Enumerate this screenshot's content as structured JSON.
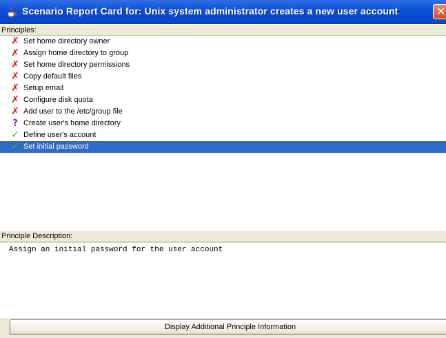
{
  "window": {
    "title": "Scenario Report Card for: Unix system administrator creates a new user account",
    "close_glyph": "✕",
    "title_icon": "java-coffee-icon"
  },
  "principles": {
    "header": "Principles:",
    "items": [
      {
        "label": "Set home directory owner",
        "status": "fail",
        "glyph": "✗"
      },
      {
        "label": "Assign home directory to group",
        "status": "fail",
        "glyph": "✗"
      },
      {
        "label": "Set home directory permissions",
        "status": "fail",
        "glyph": "✗"
      },
      {
        "label": "Copy default files",
        "status": "fail",
        "glyph": "✗"
      },
      {
        "label": "Setup email",
        "status": "fail",
        "glyph": "✗"
      },
      {
        "label": "Configure disk quota",
        "status": "fail",
        "glyph": "✗"
      },
      {
        "label": "Add user to the /etc/group file",
        "status": "fail",
        "glyph": "✗"
      },
      {
        "label": "Create user's home directory",
        "status": "unknown",
        "glyph": "?"
      },
      {
        "label": "Define user's account",
        "status": "pass",
        "glyph": "✓"
      },
      {
        "label": "Set initial password",
        "status": "pass",
        "glyph": "✓",
        "selected": true
      }
    ]
  },
  "description": {
    "header": "Principle Description:",
    "text": "Assign an initial password for the user account"
  },
  "actions": {
    "display_info_label": "Display Additional Principle Information"
  },
  "colors": {
    "titlebar": "#0a4fd6",
    "selection": "#316ac5",
    "fail": "#e01010",
    "unknown": "#7a1fb0",
    "pass": "#2ec41a"
  }
}
